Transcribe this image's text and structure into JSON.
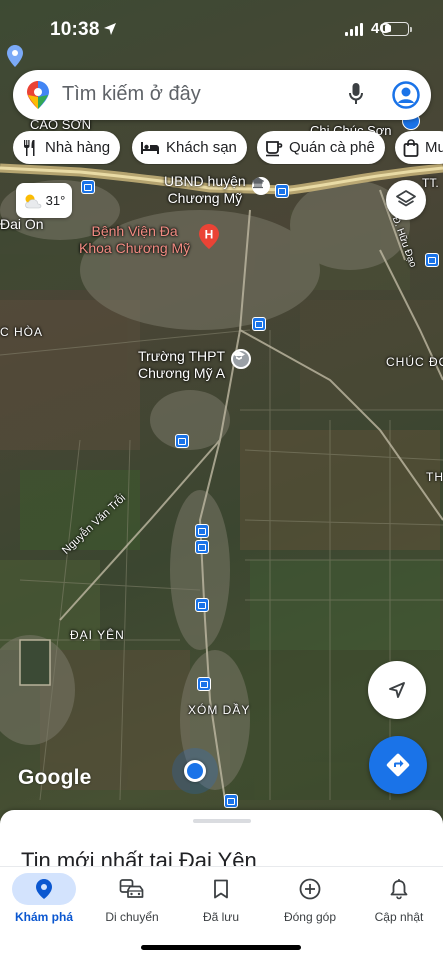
{
  "status_bar": {
    "time": "10:38",
    "network": "4G"
  },
  "search": {
    "placeholder": "Tìm kiếm ở đây"
  },
  "chips": [
    {
      "label": "Nhà hàng",
      "icon": "fork-knife-icon"
    },
    {
      "label": "Khách sạn",
      "icon": "bed-icon"
    },
    {
      "label": "Quán cà phê",
      "icon": "coffee-cup-icon"
    },
    {
      "label": "Mu",
      "icon": "shopping-bag-icon"
    }
  ],
  "weather": {
    "temperature": "31°",
    "icon": "partly-cloudy-icon"
  },
  "map_labels": {
    "cao_son": "CAO SƠN",
    "chi_chuc_son": "Chi Chúc Sơn",
    "ubnd_line1": "UBND huyện",
    "ubnd_line2": "Chương Mỹ",
    "tt": "TT.",
    "dai_on": "Đai On",
    "hospital_line1": "Bệnh Viện Đa",
    "hospital_line2": "Khoa Chương Mỹ",
    "c_hoa": "C HÒA",
    "school_line1": "Trường THPT",
    "school_line2": "Chương Mỹ A",
    "chuc_do": "CHÚC ĐO",
    "th": "TH",
    "nguyen_van_troi": "Nguyễn Văn Trỗi",
    "dai_yen": "ĐẠI YÊN",
    "xom_day": "XÓM DẦY",
    "road_label": "Đ. Hữu Đạo"
  },
  "google_logo": "Google",
  "sheet": {
    "title": "Tin mới nhất tại Đại Yên"
  },
  "nav": [
    {
      "label": "Khám phá",
      "icon": "explore-pin-icon",
      "active": true
    },
    {
      "label": "Di chuyển",
      "icon": "commute-car-icon",
      "active": false
    },
    {
      "label": "Đã lưu",
      "icon": "bookmark-icon",
      "active": false
    },
    {
      "label": "Đóng góp",
      "icon": "add-circle-icon",
      "active": false
    },
    {
      "label": "Cập nhật",
      "icon": "bell-icon",
      "active": false
    }
  ],
  "colors": {
    "accent": "#1a73e8",
    "active_nav_bg": "#d3e3fd",
    "active_nav_text": "#0b57d0"
  }
}
